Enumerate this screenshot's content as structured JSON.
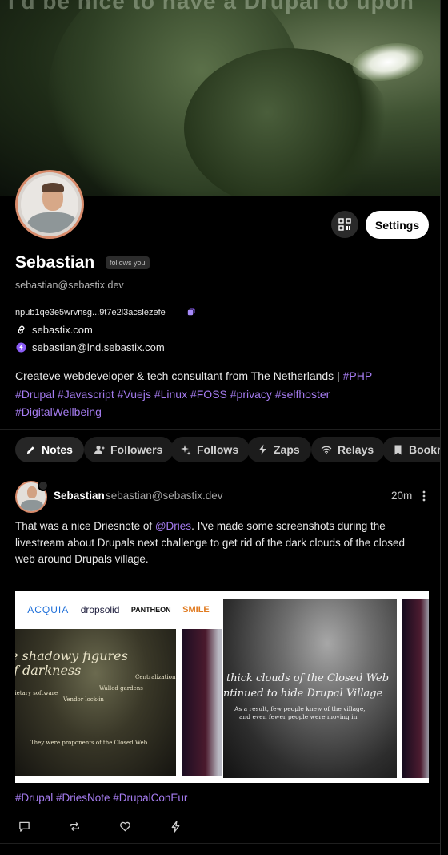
{
  "banner": {
    "overlay_text": "I'd be nice to have a Drupal to upon"
  },
  "profile": {
    "name": "Sebastian",
    "follows_you_badge": "follows you",
    "nip05": "sebastian@sebastix.dev",
    "npub": "npub1qe3e5wrvnsg...9t7e2l3acslezefe",
    "website": "sebastix.com",
    "lightning": "sebastian@lnd.sebastix.com",
    "about_text": "Createve webdeveloper & tech consultant from The Netherlands | ",
    "about_tags": [
      "#PHP",
      "#Drupal",
      "#Javascript",
      "#Vuejs",
      "#Linux",
      "#FOSS",
      "#privacy",
      "#selfhoster",
      "#DigitalWellbeing"
    ]
  },
  "buttons": {
    "settings_label": "Settings"
  },
  "tabs": [
    {
      "label": "Notes",
      "icon": "pencil-icon",
      "active": true
    },
    {
      "label": "Followers",
      "icon": "users-icon",
      "active": false
    },
    {
      "label": "Follows",
      "icon": "sparkle-icon",
      "active": false
    },
    {
      "label": "Zaps",
      "icon": "bolt-icon",
      "active": false
    },
    {
      "label": "Relays",
      "icon": "wifi-icon",
      "active": false
    },
    {
      "label": "Bookm",
      "icon": "bookmark-icon",
      "active": false
    }
  ],
  "note": {
    "author": "Sebastian",
    "handle": "sebastian@sebastix.dev",
    "time": "20m",
    "text_before": "That was a nice Driesnote of ",
    "mention": "@Dries",
    "text_after": ". I've made some screenshots during the livestream about Drupals next challenge to get rid of the dark clouds of the closed web around Drupals village.",
    "hashtags": "#Drupal #DriesNote #DrupalConEur",
    "images": {
      "slide1_logos": [
        "ACQUIA",
        "dropsolid",
        "PANTHEON",
        "SMILE"
      ],
      "slide1_title_line1": "e shadowy figures",
      "slide1_title_line2": "f darkness",
      "slide1_words": [
        "Centralization",
        "rietary software",
        "Walled gardens",
        "Vendor lock-in"
      ],
      "slide1_caption": "They were proponents of the Closed Web.",
      "slide2_title_line1": "thick clouds of the Closed Web",
      "slide2_title_line2": "ntinued to hide Drupal Village",
      "slide2_caption_line1": "As a result, few people knew of the village,",
      "slide2_caption_line2": "and even fewer people were moving in"
    }
  },
  "colors": {
    "accent": "#a57cf0",
    "avatar_ring": "#d88a6a"
  }
}
